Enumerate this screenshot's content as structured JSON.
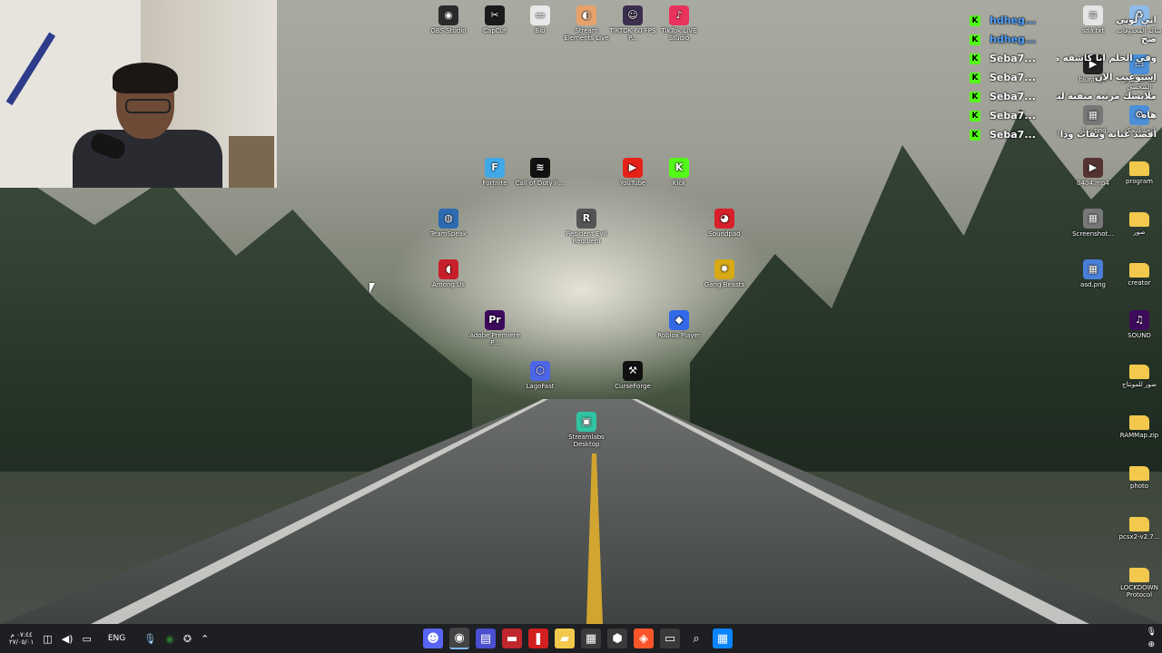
{
  "desktop_icons": [
    {
      "label": "OBS Studio",
      "color": "#2b2b2b",
      "glyph": "◉"
    },
    {
      "label": "CapCut",
      "color": "#1a1a1a",
      "glyph": "✂"
    },
    {
      "label": "Blu",
      "color": "#e8e8e8",
      "glyph": "▭"
    },
    {
      "label": "Stream Elements Live",
      "color": "#e7a16b",
      "glyph": "◐"
    },
    {
      "label": "TIKTOK 60 FPS P...",
      "color": "#3b2e4e",
      "glyph": "☺"
    },
    {
      "label": "TikTok LIVE Studio",
      "color": "#e8345c",
      "glyph": "♪"
    },
    {
      "label": "Fortnite",
      "color": "#3fa9e8",
      "glyph": "F"
    },
    {
      "label": "Call of Duty®...",
      "color": "#111",
      "glyph": "≋"
    },
    {
      "label": "YouTube",
      "color": "#e62117",
      "glyph": "▶"
    },
    {
      "label": "Kick",
      "color": "#53fc18",
      "glyph": "K"
    },
    {
      "label": "TeamSpeak",
      "color": "#2c6ab2",
      "glyph": "◍"
    },
    {
      "label": "Resident Evil Requiem",
      "color": "#555",
      "glyph": "R"
    },
    {
      "label": "Soundpad",
      "color": "#d8202a",
      "glyph": "◕"
    },
    {
      "label": "Among Us",
      "color": "#c8202a",
      "glyph": "◖"
    },
    {
      "label": "Gang Beasts",
      "color": "#d7a915",
      "glyph": "✹"
    },
    {
      "label": "Adobe Premiere P...",
      "color": "#3d0b5c",
      "glyph": "Pr"
    },
    {
      "label": "Roblox Player",
      "color": "#3368e6",
      "glyph": "◆"
    },
    {
      "label": "LagoFast",
      "color": "#4d66e6",
      "glyph": "⬡"
    },
    {
      "label": "CurseForge",
      "color": "#111",
      "glyph": "⚒"
    },
    {
      "label": "Streamlabs Desktop",
      "color": "#31c3a2",
      "glyph": "▣"
    },
    {
      "label": "ساكة المحذوفات",
      "color": "#8fbbe8",
      "glyph": "♻"
    },
    {
      "label": "sda.txt",
      "color": "#e5e5e5",
      "glyph": "≡"
    },
    {
      "label": "هذا الكمبيوتر الشخصي",
      "color": "#4a8fd8",
      "glyph": "▭"
    },
    {
      "label": "blur.mp4",
      "color": "#222",
      "glyph": "▶"
    },
    {
      "label": "لوحة التحكم",
      "color": "#4a8fd8",
      "glyph": "⚙"
    },
    {
      "label": "ستار.png",
      "color": "#777",
      "glyph": "▦"
    },
    {
      "label": "0404.mp4",
      "color": "#533",
      "glyph": "▶"
    },
    {
      "label": "program",
      "color": "#f2c94c",
      "glyph": ""
    },
    {
      "label": "Screenshot...",
      "color": "#777",
      "glyph": "▦"
    },
    {
      "label": "صور",
      "color": "#f2c94c",
      "glyph": ""
    },
    {
      "label": "asd.png",
      "color": "#4a7fd8",
      "glyph": "▦"
    },
    {
      "label": "creator",
      "color": "#f2c94c",
      "glyph": ""
    },
    {
      "label": "SOUND",
      "color": "#3d0b5c",
      "glyph": "♫"
    },
    {
      "label": "صور للمونتاج",
      "color": "#f2c94c",
      "glyph": ""
    },
    {
      "label": "RAMMap.zip",
      "color": "#f2c94c",
      "glyph": ""
    },
    {
      "label": "photo",
      "color": "#f2c94c",
      "glyph": ""
    },
    {
      "label": "pcsx2-v2.7...",
      "color": "#f2c94c",
      "glyph": ""
    },
    {
      "label": "LOCKDOWN Protocol",
      "color": "#f2c94c",
      "glyph": ""
    }
  ],
  "chat": [
    {
      "name": "hdheg...",
      "name_color": "#4fa0ff",
      "message": "اني لوني"
    },
    {
      "name": "hdheg...",
      "name_color": "#4fa0ff",
      "message": "صح"
    },
    {
      "name": "Seba7...",
      "name_color": "#ffffff",
      "message": "وفي الحلم انا كاشفه ماني"
    },
    {
      "name": "Seba7...",
      "name_color": "#ffffff",
      "message": "استوعبت الان"
    },
    {
      "name": "Seba7...",
      "name_color": "#ffffff",
      "message": "ملابسك مرتبة منقبة ليه"
    },
    {
      "name": "Seba7...",
      "name_color": "#ffffff",
      "message": "هاه"
    },
    {
      "name": "Seba7...",
      "name_color": "#ffffff",
      "message": "اقصد عباية ونقاب وذا ك"
    }
  ],
  "taskbar": {
    "language": "ENG",
    "clock_time": "٠٧:٤٤ م",
    "clock_date": "٢٧/٠٥/٠١",
    "apps": [
      {
        "name": "discord-icon",
        "glyph": "☻",
        "color": "#5865f2"
      },
      {
        "name": "obs-icon",
        "glyph": "◉",
        "color": "#444",
        "active": true
      },
      {
        "name": "streamlabs-icon",
        "glyph": "▤",
        "color": "#4a4fd0"
      },
      {
        "name": "live-icon",
        "glyph": "▬",
        "color": "#c0262c"
      },
      {
        "name": "pin-icon",
        "glyph": "❚",
        "color": "#d21f1f"
      },
      {
        "name": "folder-icon",
        "glyph": "▰",
        "color": "#f2c94c"
      },
      {
        "name": "store-icon",
        "glyph": "▦",
        "color": "#3a3a3a"
      },
      {
        "name": "settings-icon",
        "glyph": "⬢",
        "color": "#3a3a3a"
      },
      {
        "name": "brave-icon",
        "glyph": "◈",
        "color": "#fb542b"
      },
      {
        "name": "taskview-icon",
        "glyph": "▭",
        "color": "#3a3a3a"
      },
      {
        "name": "search-icon",
        "glyph": "⌕",
        "color": "#1d1f22"
      },
      {
        "name": "start-icon",
        "glyph": "▦",
        "color": "#0a84ff"
      }
    ]
  }
}
